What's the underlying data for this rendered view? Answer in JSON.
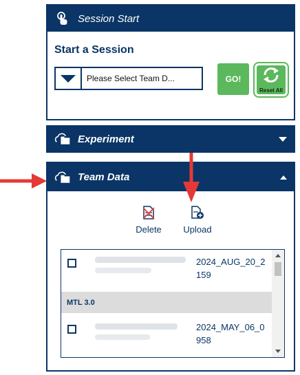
{
  "session": {
    "header": "Session Start",
    "title": "Start a Session",
    "select_text": "Please Select Team D...",
    "go_label": "GO!",
    "reset_label": "Reset All"
  },
  "experiment": {
    "header": "Experiment"
  },
  "team_data": {
    "header": "Team Data",
    "delete_label": "Delete",
    "upload_label": "Upload",
    "rows": [
      {
        "date_line1": "2024_AUG_20_2",
        "date_line2": "159"
      },
      {
        "group": "MTL 3.0"
      },
      {
        "date_line1": "2024_MAY_06_0",
        "date_line2": "958"
      }
    ]
  },
  "colors": {
    "navy": "#0a3566",
    "go_green": "#5cb85c",
    "annotation_red": "#e53935"
  }
}
